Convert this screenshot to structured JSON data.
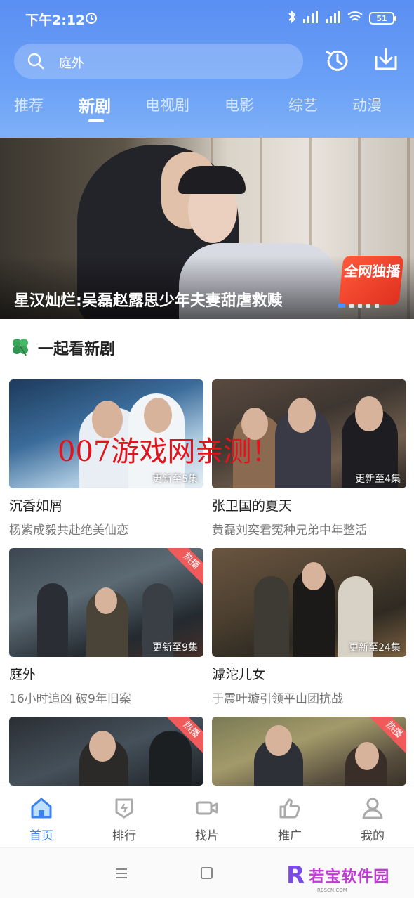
{
  "status": {
    "time": "下午2:12",
    "battery": "51"
  },
  "search": {
    "text": "庭外"
  },
  "tabs": [
    {
      "label": "推荐"
    },
    {
      "label": "新剧"
    },
    {
      "label": "电视剧"
    },
    {
      "label": "电影"
    },
    {
      "label": "综艺"
    },
    {
      "label": "动漫"
    }
  ],
  "active_tab": "新剧",
  "banner": {
    "title": "星汉灿烂:吴磊赵露思少年夫妻甜虐救赎",
    "badge": "全网独播",
    "page_index": 1,
    "page_count": 5
  },
  "section": {
    "title": "一起看新剧",
    "icon": "clover-icon"
  },
  "cards": [
    {
      "name": "沉香如屑",
      "desc": "杨紫成毅共赴绝美仙恋",
      "episode": "更新至5集",
      "hot": ""
    },
    {
      "name": "张卫国的夏天",
      "desc": "黄磊刘奕君冤种兄弟中年整活",
      "episode": "更新至4集",
      "hot": ""
    },
    {
      "name": "庭外",
      "desc": "16小时追凶 破9年旧案",
      "episode": "更新至9集",
      "hot": "热播"
    },
    {
      "name": "滹沱儿女",
      "desc": "于震叶璇引领平山团抗战",
      "episode": "更新至24集",
      "hot": ""
    },
    {
      "name": "",
      "desc": "",
      "episode": "",
      "hot": "热播"
    },
    {
      "name": "",
      "desc": "",
      "episode": "",
      "hot": "热播"
    }
  ],
  "watermark": "007游戏网亲测！",
  "nav": [
    {
      "label": "首页",
      "icon": "home-icon"
    },
    {
      "label": "排行",
      "icon": "ranking-icon"
    },
    {
      "label": "找片",
      "icon": "video-camera-icon"
    },
    {
      "label": "推广",
      "icon": "thumbs-up-icon"
    },
    {
      "label": "我的",
      "icon": "person-icon"
    }
  ],
  "logo": {
    "text": "若宝软件园",
    "sub": "RBSCN.COM"
  },
  "colors": {
    "header": "#5a8ff3",
    "accent": "#3b82f6",
    "hot": "#f05a5a",
    "watermark": "#e3121b"
  }
}
